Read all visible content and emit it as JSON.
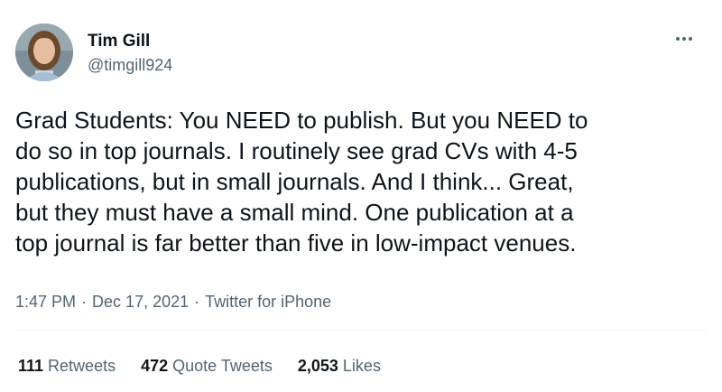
{
  "author": {
    "display_name": "Tim Gill",
    "handle": "@timgill924",
    "avatar_icon": "profile-photo"
  },
  "more_icon": "ellipsis-icon",
  "tweet": {
    "text": "Grad Students: You NEED to publish. But you NEED to\ndo so in top journals. I routinely see grad CVs with 4-5\npublications, but in small journals. And I think... Great,\nbut they must have a small mind. One publication at a\ntop journal is far better than five in low-impact venues."
  },
  "meta": {
    "time": "1:47 PM",
    "separator": "·",
    "date": "Dec 17, 2021",
    "source": "Twitter for iPhone"
  },
  "stats": {
    "retweets_count": "111",
    "retweets_label": "Retweets",
    "quotes_count": "472",
    "quotes_label": "Quote Tweets",
    "likes_count": "2,053",
    "likes_label": "Likes"
  },
  "colors": {
    "primary_text": "#0f1419",
    "secondary_text": "#536471",
    "divider": "#eff3f4"
  }
}
